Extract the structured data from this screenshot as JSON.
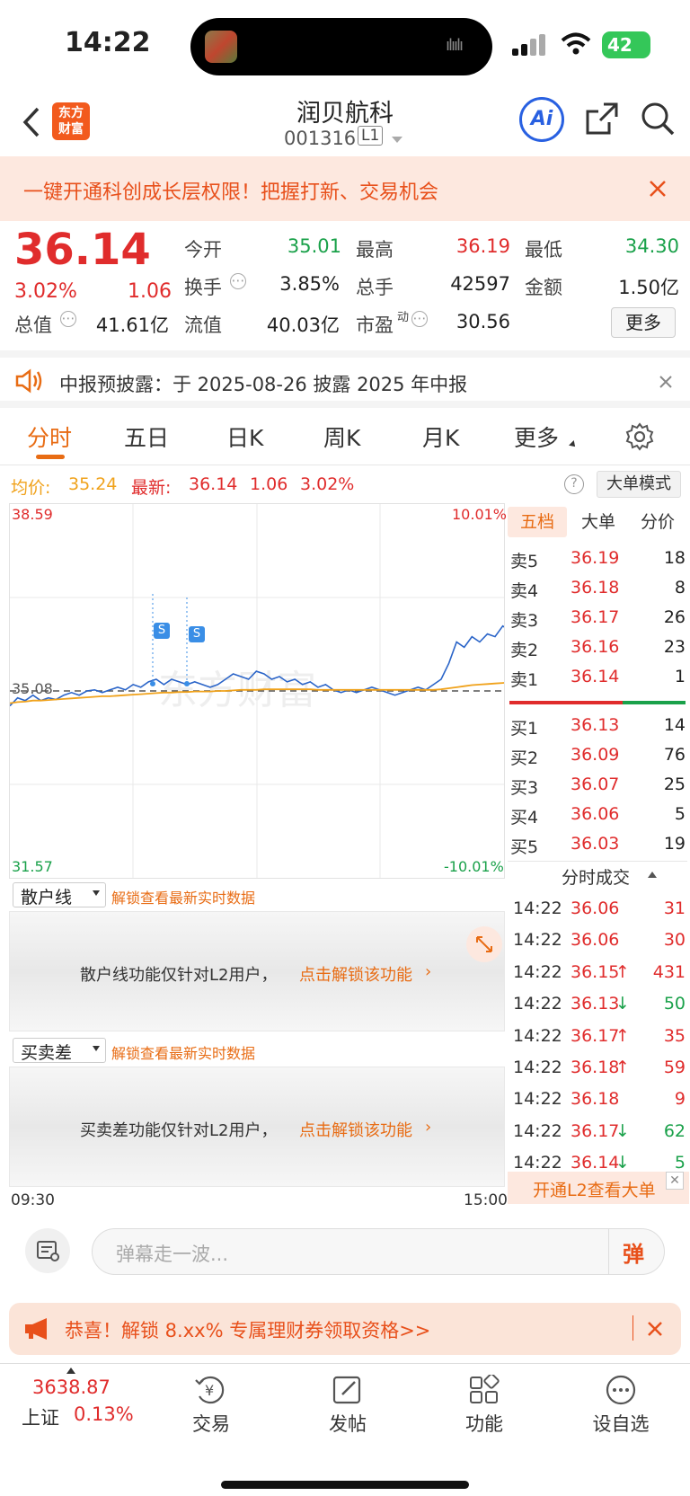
{
  "status": {
    "time": "14:22",
    "battery": "42"
  },
  "header": {
    "title": "润贝航科",
    "code": "001316",
    "level": "L1",
    "logo_line1": "东方",
    "logo_line2": "财富",
    "ai_label": "Ai"
  },
  "promo": {
    "text": "一键开通科创成长层权限！把握打新、交易机会"
  },
  "quote": {
    "price": "36.14",
    "pct": "3.02%",
    "change": "1.06",
    "cells": [
      {
        "label": "今开",
        "value": "35.01"
      },
      {
        "label": "最高",
        "value": "36.19"
      },
      {
        "label": "最低",
        "value": "34.30"
      },
      {
        "label": "换手",
        "value": "3.85%"
      },
      {
        "label": "总手",
        "value": "42597"
      },
      {
        "label": "金额",
        "value": "1.50亿"
      },
      {
        "label": "总值",
        "value": "41.61亿"
      },
      {
        "label": "流值",
        "value": "40.03亿"
      },
      {
        "label": "市盈",
        "value": "30.56",
        "sup": "动"
      }
    ],
    "more": "更多"
  },
  "notice": {
    "text": "中报预披露：于 2025-08-26 披露 2025 年中报"
  },
  "tabs": [
    "分时",
    "五日",
    "日K",
    "周K",
    "月K",
    "更多"
  ],
  "pricebar": {
    "avg_label": "均价:",
    "avg": "35.24",
    "latest_label": "最新:",
    "latest": "36.14",
    "chg": "1.06",
    "pct": "3.02%",
    "bigmode": "大单模式",
    "help": "?"
  },
  "chart_data": {
    "type": "line",
    "y_top": "38.59",
    "y_mid": "35.08",
    "y_bottom": "31.57",
    "pct_top": "10.01%",
    "pct_bottom": "-10.01%",
    "x_start": "09:30",
    "x_end": "15:00",
    "ylim": [
      31.57,
      38.59
    ],
    "prev_close": 35.08,
    "markers": [
      "S",
      "S"
    ],
    "watermark": "东方财富",
    "series": [
      {
        "values": [
          34.8,
          34.95,
          34.9,
          35.0,
          34.9,
          34.95,
          34.92,
          35.0,
          35.05,
          35.0,
          35.08,
          35.1,
          35.05,
          35.1,
          35.15,
          35.1,
          35.2,
          35.15,
          35.25,
          35.3,
          35.2,
          35.3,
          35.25,
          35.2,
          35.25,
          35.2,
          35.15,
          35.2,
          35.3,
          35.4,
          35.35,
          35.3,
          35.45,
          35.4,
          35.3,
          35.35,
          35.25,
          35.3,
          35.2,
          35.25,
          35.15,
          35.2,
          35.1,
          35.05,
          35.1,
          35.05,
          35.1,
          35.15,
          35.1,
          35.05,
          35.0,
          35.05,
          35.1,
          35.15,
          35.1,
          35.2,
          35.3,
          35.6,
          36.0,
          35.9,
          36.1,
          36.0,
          36.15,
          36.1,
          36.3,
          36.2,
          36.35
        ]
      },
      {
        "values": [
          34.85,
          34.87,
          34.88,
          34.9,
          34.9,
          34.91,
          34.92,
          34.93,
          34.94,
          34.95,
          34.96,
          34.97,
          34.98,
          34.98,
          34.99,
          35.0,
          35.01,
          35.02,
          35.03,
          35.04,
          35.05,
          35.05,
          35.06,
          35.06,
          35.07,
          35.07,
          35.07,
          35.08,
          35.08,
          35.09,
          35.1,
          35.1,
          35.1,
          35.11,
          35.11,
          35.11,
          35.11,
          35.11,
          35.11,
          35.11,
          35.1,
          35.1,
          35.1,
          35.1,
          35.1,
          35.1,
          35.1,
          35.1,
          35.1,
          35.1,
          35.1,
          35.1,
          35.1,
          35.1,
          35.1,
          35.1,
          35.11,
          35.13,
          35.15,
          35.17,
          35.19,
          35.2,
          35.21,
          35.22,
          35.23,
          35.24,
          35.25
        ]
      }
    ]
  },
  "orderbook": {
    "tabs": [
      "五档",
      "大单",
      "分价"
    ],
    "sells": [
      {
        "label": "卖5",
        "price": "36.19",
        "vol": "18"
      },
      {
        "label": "卖4",
        "price": "36.18",
        "vol": "8"
      },
      {
        "label": "卖3",
        "price": "36.17",
        "vol": "26"
      },
      {
        "label": "卖2",
        "price": "36.16",
        "vol": "23"
      },
      {
        "label": "卖1",
        "price": "36.14",
        "vol": "1"
      }
    ],
    "buys": [
      {
        "label": "买1",
        "price": "36.13",
        "vol": "14"
      },
      {
        "label": "买2",
        "price": "36.09",
        "vol": "76"
      },
      {
        "label": "买3",
        "price": "36.07",
        "vol": "25"
      },
      {
        "label": "买4",
        "price": "36.06",
        "vol": "5"
      },
      {
        "label": "买5",
        "price": "36.03",
        "vol": "19"
      }
    ],
    "ticks_title": "分时成交",
    "ticks": [
      {
        "time": "14:22",
        "price": "36.06",
        "vol": "31",
        "dir": "",
        "color": "red"
      },
      {
        "time": "14:22",
        "price": "36.06",
        "vol": "30",
        "dir": "",
        "color": "red"
      },
      {
        "time": "14:22",
        "price": "36.15",
        "vol": "431",
        "dir": "↑",
        "color": "red"
      },
      {
        "time": "14:22",
        "price": "36.13",
        "vol": "50",
        "dir": "↓",
        "color": "green"
      },
      {
        "time": "14:22",
        "price": "36.17",
        "vol": "35",
        "dir": "↑",
        "color": "red"
      },
      {
        "time": "14:22",
        "price": "36.18",
        "vol": "59",
        "dir": "↑",
        "color": "red"
      },
      {
        "time": "14:22",
        "price": "36.18",
        "vol": "9",
        "dir": "",
        "color": "red"
      },
      {
        "time": "14:22",
        "price": "36.17",
        "vol": "62",
        "dir": "↓",
        "color": "green"
      },
      {
        "time": "14:22",
        "price": "36.14",
        "vol": "5",
        "dir": "↓",
        "color": "green"
      }
    ],
    "l2_link": "开通L2查看大单"
  },
  "sub1": {
    "select": "散户线",
    "unlock": "解锁查看最新实时数据",
    "msg": "散户线功能仅针对L2用户，",
    "link": "点击解锁该功能"
  },
  "sub2": {
    "select": "买卖差",
    "unlock": "解锁查看最新实时数据",
    "msg": "买卖差功能仅针对L2用户，",
    "link": "点击解锁该功能"
  },
  "danmu": {
    "placeholder": "弹幕走一波...",
    "button": "弹"
  },
  "banner": {
    "text": "恭喜！解锁 8.xx% 专属理财券领取资格>>"
  },
  "bottom": {
    "index_value": "3638.87",
    "index_name": "上证",
    "index_pct": "0.13%",
    "items": [
      "交易",
      "发帖",
      "功能",
      "设自选"
    ]
  },
  "colors": {
    "up": "#e02c2c",
    "down": "#1aa14a",
    "accent": "#e86c14",
    "avg_line": "#f0a21b",
    "price_line": "#2a64c8"
  }
}
